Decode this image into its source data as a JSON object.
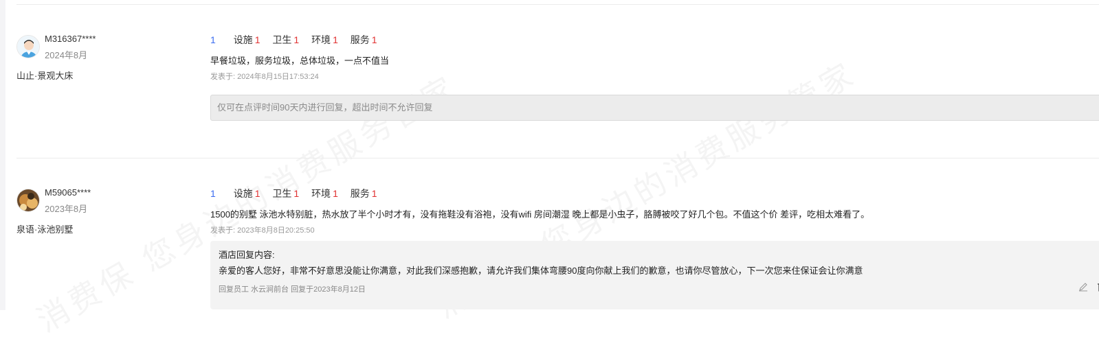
{
  "watermark": "消费保 您身边的消费服务管家",
  "reviews": [
    {
      "user": "M316367****",
      "date": "2024年8月",
      "room": "山止·景观大床",
      "overall_score": "1",
      "scores": [
        {
          "label": "设施",
          "value": "1"
        },
        {
          "label": "卫生",
          "value": "1"
        },
        {
          "label": "环境",
          "value": "1"
        },
        {
          "label": "服务",
          "value": "1"
        }
      ],
      "content": "早餐垃圾，服务垃圾，总体垃圾，一点不值当",
      "posted": "发表于: 2024年8月15日17:53:24",
      "reply_notice": "仅可在点评时间90天内进行回复，超出时间不允许回复"
    },
    {
      "user": "M59065****",
      "date": "2023年8月",
      "room": "泉语·泳池别墅",
      "overall_score": "1",
      "scores": [
        {
          "label": "设施",
          "value": "1"
        },
        {
          "label": "卫生",
          "value": "1"
        },
        {
          "label": "环境",
          "value": "1"
        },
        {
          "label": "服务",
          "value": "1"
        }
      ],
      "content": "1500的别墅 泳池水特别脏，热水放了半个小时才有，没有拖鞋没有浴袍，没有wifi 房间潮湿 晚上都是小虫子，胳膊被咬了好几个包。不值这个价 差评，吃相太难看了。",
      "posted": "发表于: 2023年8月8日20:25:50",
      "hotel_reply": {
        "title": "酒店回复内容:",
        "text": "亲爱的客人您好，非常不好意思没能让你满意，对此我们深感抱歉，请允许我们集体弯腰90度向你献上我们的歉意，也请你尽管放心，下一次您来住保证会让你满意",
        "meta": "回复员工 水云涧前台 回复于2023年8月12日"
      }
    }
  ],
  "colors": {
    "overall_score": "#3b6cf0",
    "score_value": "#e03030",
    "muted_text": "#999999"
  }
}
